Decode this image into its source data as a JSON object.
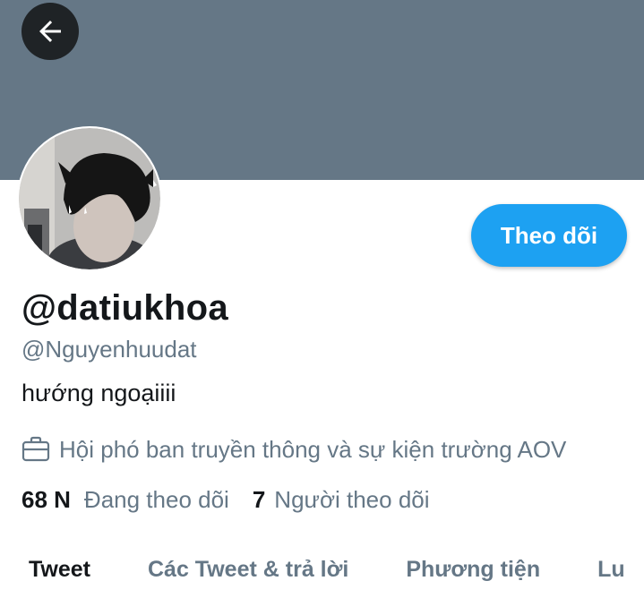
{
  "header": {
    "back_icon": "arrow-left-icon",
    "banner_color": "#657786"
  },
  "profile": {
    "display_name": "@datiukhoa",
    "handle": "@Nguyenhuudat",
    "bio": "hướng ngoạiiii",
    "job_icon": "briefcase-icon",
    "job": "Hội phó ban truyền thông và sự kiện trường AOV",
    "follow_label": "Theo dõi",
    "following_count": "68 N",
    "following_label": "Đang theo dõi",
    "followers_count": "7",
    "followers_label": "Người theo dõi"
  },
  "tabs": [
    {
      "label": "Tweet",
      "active": true
    },
    {
      "label": "Các Tweet & trả lời",
      "active": false
    },
    {
      "label": "Phương tiện",
      "active": false
    },
    {
      "label": "Lu",
      "active": false
    }
  ],
  "colors": {
    "accent": "#1da1f2",
    "text_primary": "#14171a",
    "text_secondary": "#657786"
  }
}
